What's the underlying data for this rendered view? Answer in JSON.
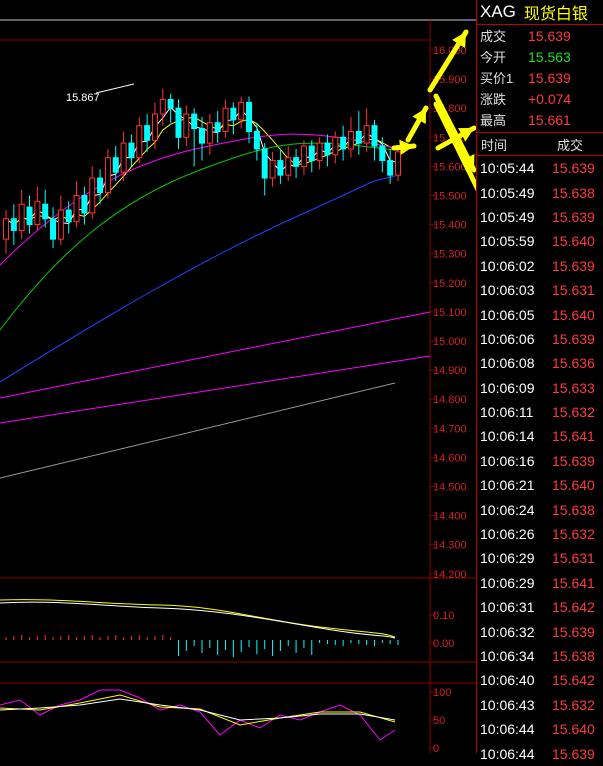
{
  "quote": {
    "symbol": "XAG",
    "name": "现货白银",
    "rows": [
      {
        "label": "成交",
        "value": "15.639",
        "color": "#ff3a3a"
      },
      {
        "label": "今开",
        "value": "15.563",
        "color": "#22dd22"
      },
      {
        "label": "买价1",
        "value": "15.639",
        "color": "#ff3a3a"
      },
      {
        "label": "涨跌",
        "value": "+0.074",
        "color": "#ff3a3a"
      },
      {
        "label": "最高",
        "value": "15.661",
        "color": "#ff3a3a"
      }
    ]
  },
  "ticks": {
    "col_time": "时间",
    "col_price": "成交",
    "rows": [
      {
        "time": "10:05:44",
        "price": "15.639"
      },
      {
        "time": "10:05:49",
        "price": "15.638"
      },
      {
        "time": "10:05:49",
        "price": "15.639"
      },
      {
        "time": "10:05:59",
        "price": "15.640"
      },
      {
        "time": "10:06:02",
        "price": "15.639"
      },
      {
        "time": "10:06:03",
        "price": "15.631"
      },
      {
        "time": "10:06:05",
        "price": "15.640"
      },
      {
        "time": "10:06:06",
        "price": "15.639"
      },
      {
        "time": "10:06:08",
        "price": "15.636"
      },
      {
        "time": "10:06:09",
        "price": "15.633"
      },
      {
        "time": "10:06:11",
        "price": "15.632"
      },
      {
        "time": "10:06:14",
        "price": "15.641"
      },
      {
        "time": "10:06:16",
        "price": "15.639"
      },
      {
        "time": "10:06:21",
        "price": "15.640"
      },
      {
        "time": "10:06:24",
        "price": "15.638"
      },
      {
        "time": "10:06:26",
        "price": "15.632"
      },
      {
        "time": "10:06:29",
        "price": "15.631"
      },
      {
        "time": "10:06:29",
        "price": "15.641"
      },
      {
        "time": "10:06:31",
        "price": "15.642"
      },
      {
        "time": "10:06:32",
        "price": "15.639"
      },
      {
        "time": "10:06:34",
        "price": "15.638"
      },
      {
        "time": "10:06:40",
        "price": "15.642"
      },
      {
        "time": "10:06:43",
        "price": "15.632"
      },
      {
        "time": "10:06:44",
        "price": "15.640"
      },
      {
        "time": "10:06:44",
        "price": "15.639"
      }
    ]
  },
  "chart_data": {
    "type": "candlestick",
    "high_label": "15.867",
    "price_axis": [
      "16.000",
      "15.900",
      "15.800",
      "15.700",
      "15.600",
      "15.500",
      "15.400",
      "15.300",
      "15.200",
      "15.100",
      "15.000",
      "14.900",
      "14.800",
      "14.700",
      "14.600",
      "14.500",
      "14.400",
      "14.300",
      "14.200"
    ],
    "macd_axis": [
      "0.10",
      "0.00"
    ],
    "kdj_axis": [
      "100",
      "50",
      "0"
    ],
    "ylim": [
      14.2,
      16.0
    ],
    "candles": [
      [
        15.35,
        15.42,
        15.3,
        15.45
      ],
      [
        15.42,
        15.38,
        15.33,
        15.47
      ],
      [
        15.38,
        15.47,
        15.35,
        15.52
      ],
      [
        15.46,
        15.4,
        15.37,
        15.5
      ],
      [
        15.4,
        15.48,
        15.38,
        15.53
      ],
      [
        15.47,
        15.42,
        15.39,
        15.52
      ],
      [
        15.42,
        15.35,
        15.32,
        15.46
      ],
      [
        15.35,
        15.45,
        15.33,
        15.5
      ],
      [
        15.45,
        15.41,
        15.37,
        15.48
      ],
      [
        15.41,
        15.5,
        15.39,
        15.55
      ],
      [
        15.5,
        15.44,
        15.4,
        15.53
      ],
      [
        15.44,
        15.56,
        15.42,
        15.6
      ],
      [
        15.56,
        15.51,
        15.47,
        15.59
      ],
      [
        15.51,
        15.63,
        15.49,
        15.66
      ],
      [
        15.63,
        15.58,
        15.55,
        15.67
      ],
      [
        15.58,
        15.68,
        15.55,
        15.72
      ],
      [
        15.68,
        15.63,
        15.6,
        15.71
      ],
      [
        15.63,
        15.74,
        15.61,
        15.77
      ],
      [
        15.74,
        15.69,
        15.65,
        15.78
      ],
      [
        15.69,
        15.78,
        15.66,
        15.82
      ],
      [
        15.78,
        15.83,
        15.74,
        15.867
      ],
      [
        15.83,
        15.8,
        15.75,
        15.85
      ],
      [
        15.8,
        15.7,
        15.66,
        15.83
      ],
      [
        15.7,
        15.78,
        15.67,
        15.81
      ],
      [
        15.78,
        15.73,
        15.6,
        15.8
      ],
      [
        15.73,
        15.68,
        15.62,
        15.77
      ],
      [
        15.68,
        15.75,
        15.64,
        15.78
      ],
      [
        15.75,
        15.72,
        15.68,
        15.79
      ],
      [
        15.72,
        15.8,
        15.7,
        15.83
      ],
      [
        15.8,
        15.76,
        15.71,
        15.82
      ],
      [
        15.76,
        15.82,
        15.73,
        15.84
      ],
      [
        15.82,
        15.72,
        15.68,
        15.84
      ],
      [
        15.72,
        15.66,
        15.62,
        15.75
      ],
      [
        15.66,
        15.56,
        15.5,
        15.68
      ],
      [
        15.56,
        15.62,
        15.53,
        15.65
      ],
      [
        15.62,
        15.57,
        15.54,
        15.66
      ],
      [
        15.57,
        15.63,
        15.55,
        15.67
      ],
      [
        15.63,
        15.6,
        15.56,
        15.66
      ],
      [
        15.6,
        15.67,
        15.57,
        15.69
      ],
      [
        15.67,
        15.62,
        15.58,
        15.69
      ],
      [
        15.62,
        15.68,
        15.59,
        15.7
      ],
      [
        15.68,
        15.64,
        15.6,
        15.71
      ],
      [
        15.64,
        15.7,
        15.61,
        15.72
      ],
      [
        15.7,
        15.66,
        15.62,
        15.74
      ],
      [
        15.66,
        15.72,
        15.63,
        15.77
      ],
      [
        15.72,
        15.68,
        15.64,
        15.79
      ],
      [
        15.68,
        15.74,
        15.65,
        15.8
      ],
      [
        15.74,
        15.67,
        15.62,
        15.76
      ],
      [
        15.67,
        15.62,
        15.58,
        15.7
      ],
      [
        15.62,
        15.57,
        15.54,
        15.66
      ],
      [
        15.57,
        15.65,
        15.55,
        15.67
      ]
    ]
  },
  "colors": {
    "up": "#ff3333",
    "down": "#00ffff",
    "grid": "#8b0000",
    "axis_text": "#d02020",
    "ma5": "#ffffff",
    "ma10": "#ffff00",
    "ma20": "#ff00ff",
    "ma60": "#00cc00",
    "ma120": "#2040ff",
    "arrow": "#ffff00"
  }
}
